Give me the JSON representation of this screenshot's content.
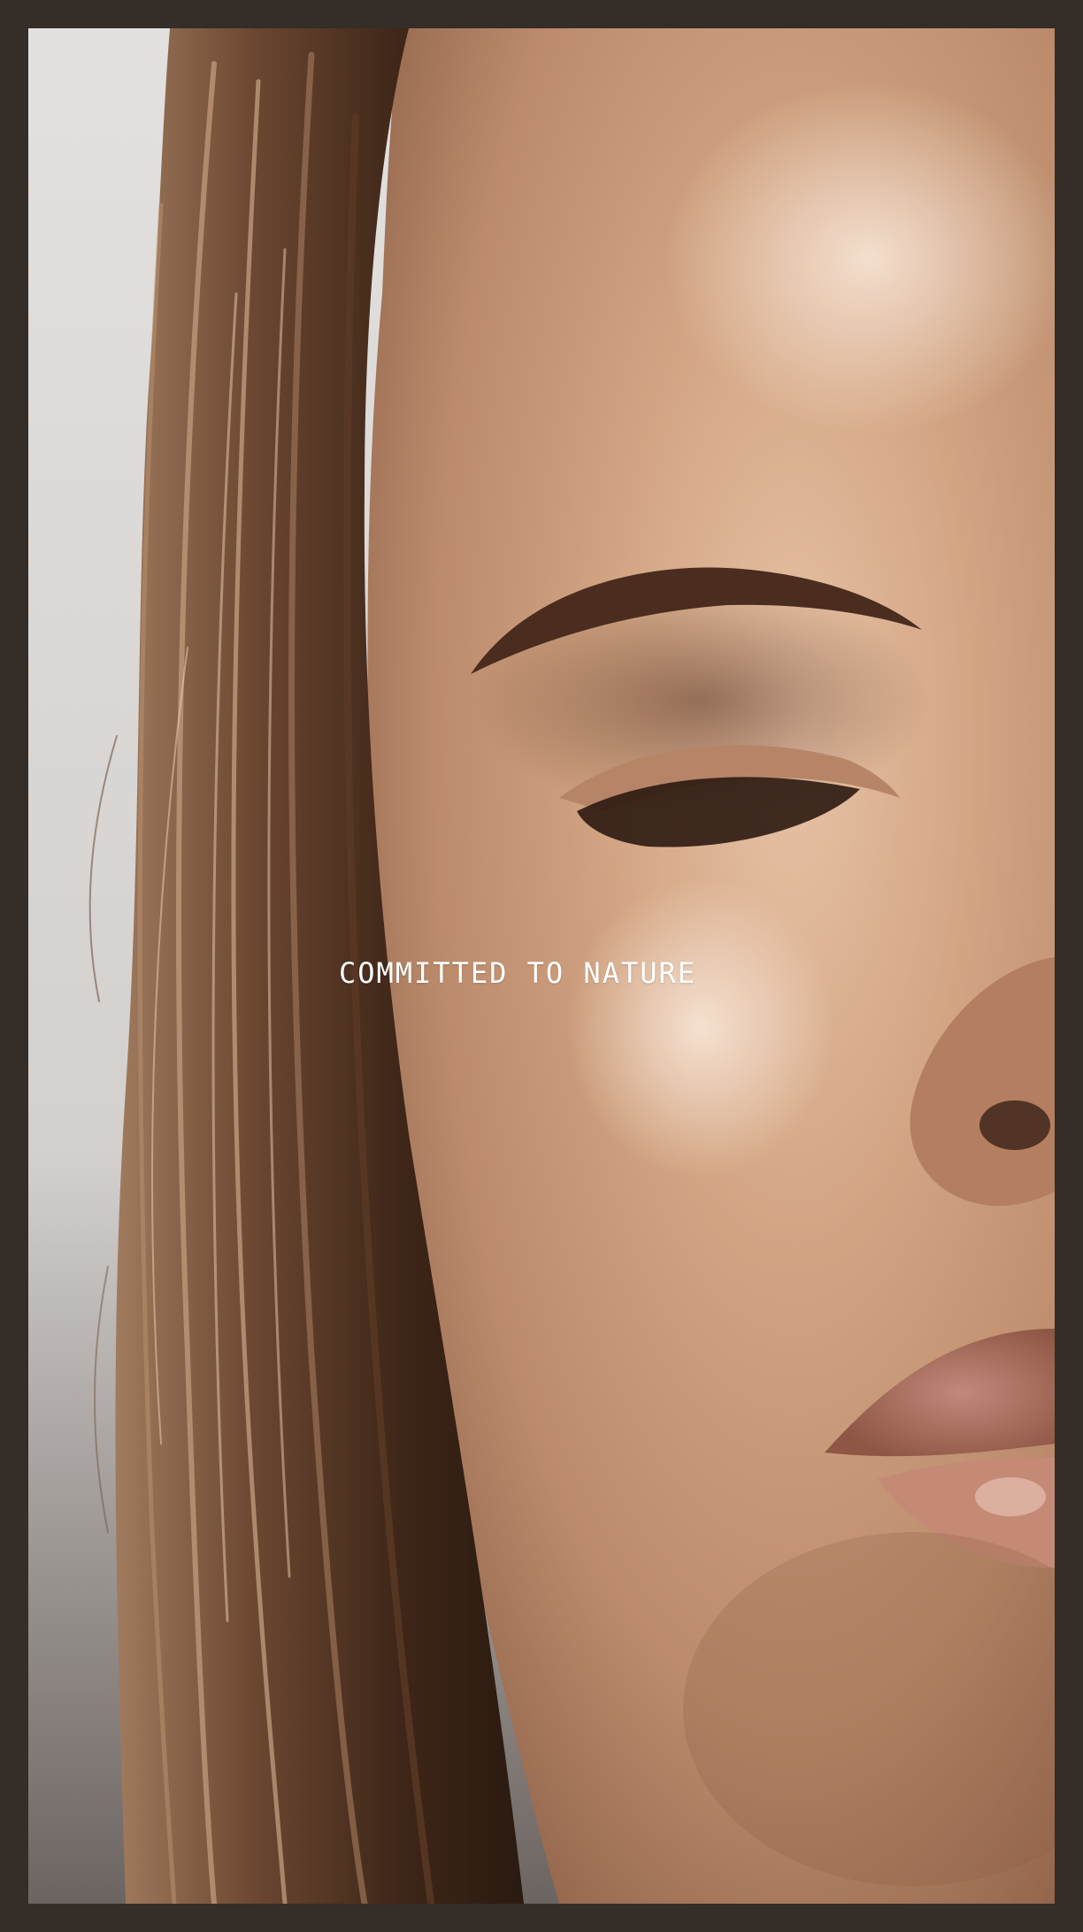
{
  "hero": {
    "tagline": "COMMITTED TO NATURE",
    "image_alt": "close-up portrait of a face with closed eye, freckled skin and wet hair"
  },
  "colors": {
    "frame": "#342d28",
    "tagline_text": "#ffffff",
    "background_wall": "#d9d6d3",
    "skin": "#c99a7a",
    "hair": "#5a3a25",
    "lips": "#a86a55"
  }
}
